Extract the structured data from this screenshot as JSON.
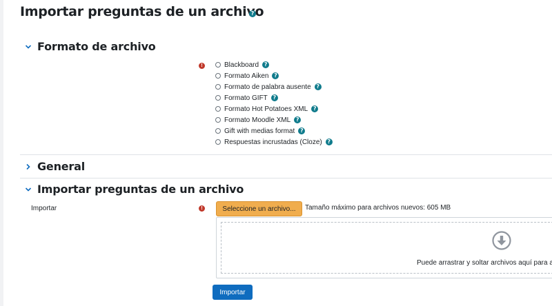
{
  "page": {
    "title": "Importar preguntas de un archivo"
  },
  "sections": {
    "format": {
      "title": "Formato de archivo",
      "options": [
        {
          "label": "Blackboard"
        },
        {
          "label": "Formato Aiken"
        },
        {
          "label": "Formato de palabra ausente"
        },
        {
          "label": "Formato GIFT"
        },
        {
          "label": "Formato Hot Potatoes XML"
        },
        {
          "label": "Formato Moodle XML"
        },
        {
          "label": "Gift with medias format"
        },
        {
          "label": "Respuestas incrustadas (Cloze)"
        }
      ]
    },
    "general": {
      "title": "General"
    },
    "import": {
      "title": "Importar preguntas de un archivo",
      "field_label": "Importar",
      "choose_button": "Seleccione un archivo...",
      "max_size": "Tamaño máximo para archivos nuevos: 605 MB",
      "drop_text": "Puede arrastrar y soltar archivos aquí para añadirlos."
    }
  },
  "actions": {
    "submit": "Importar"
  },
  "icons": {
    "help": "help-icon",
    "required": "required-icon",
    "download": "download-icon"
  },
  "colors": {
    "primary": "#0f6cbf",
    "warning": "#f0ad4e",
    "help": "#0f7b8c",
    "required": "#c0392b"
  }
}
